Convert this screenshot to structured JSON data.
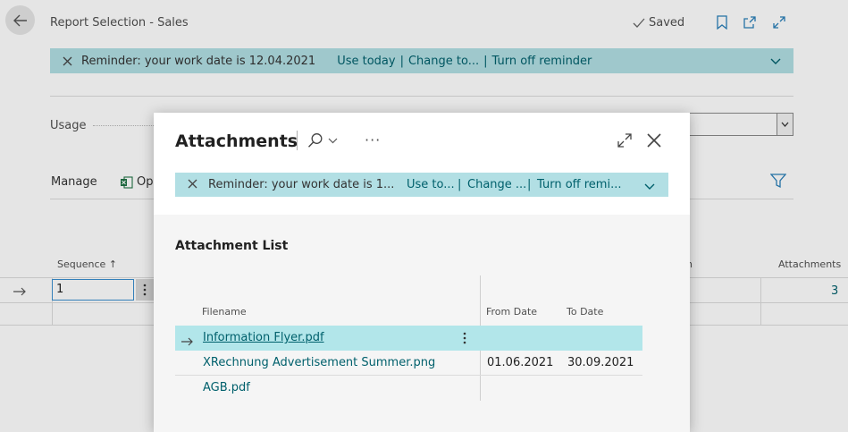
{
  "page": {
    "title": "Report Selection - Sales",
    "saved_label": "Saved",
    "banner": {
      "text": "Reminder: your work date is 12.04.2021",
      "use_today": "Use today",
      "change_to": "Change to...",
      "turn_off": "Turn off reminder"
    },
    "usage_label": "Usage",
    "manage_label": "Manage",
    "open_label": "Op",
    "grid": {
      "col_sequence": "Sequence",
      "sort_arrow": "↑",
      "col_partial": "n",
      "col_attachments": "Attachments",
      "row": {
        "sequence": "1",
        "attachments": "3"
      }
    }
  },
  "dialog": {
    "title": "Attachments",
    "more_label": "···",
    "banner": {
      "text": "Reminder: your work date is 1...",
      "use_today": "Use to...",
      "change_to": "Change ...",
      "turn_off": "Turn off remi..."
    },
    "section_title": "Attachment List",
    "columns": {
      "filename": "Filename",
      "from_date": "From Date",
      "to_date": "To Date"
    },
    "rows": [
      {
        "filename": "Information Flyer.pdf",
        "from_date": "",
        "to_date": ""
      },
      {
        "filename": "XRechnung Advertisement Summer.png",
        "from_date": "01.06.2021",
        "to_date": "30.09.2021"
      },
      {
        "filename": "AGB.pdf",
        "from_date": "",
        "to_date": ""
      }
    ]
  },
  "colors": {
    "accent": "#00606c",
    "banner_bg": "#b2dfe4",
    "selected_row": "#b2e6ea"
  },
  "icons": [
    "back-arrow-icon",
    "check-icon",
    "bookmark-icon",
    "open-new-window-icon",
    "expand-icon",
    "close-icon",
    "chevron-down-icon",
    "search-icon",
    "filter-icon",
    "excel-icon",
    "row-arrow-icon",
    "kebab-icon"
  ]
}
